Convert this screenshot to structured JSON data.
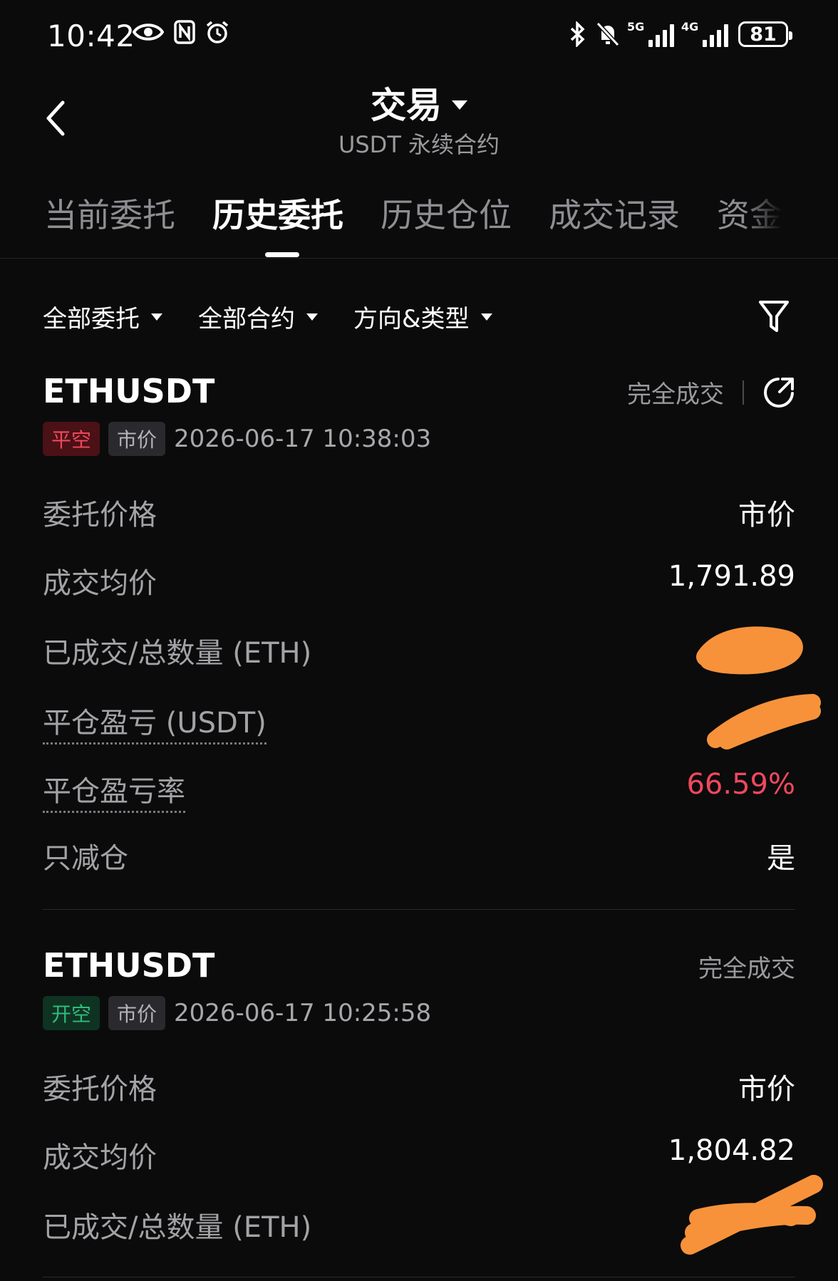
{
  "status_bar": {
    "time": "10:42",
    "icons_left": [
      "eye-icon",
      "nfc-icon",
      "alarm-icon"
    ],
    "icons_right": [
      "bluetooth-icon",
      "mute-icon",
      "signal-5g-icon",
      "signal-4g-icon"
    ],
    "net1": "5G",
    "net2": "4G",
    "battery": "81"
  },
  "header": {
    "title": "交易",
    "subtitle": "USDT 永续合约"
  },
  "tabs": [
    {
      "label": "当前委托",
      "active": false
    },
    {
      "label": "历史委托",
      "active": true
    },
    {
      "label": "历史仓位",
      "active": false
    },
    {
      "label": "成交记录",
      "active": false
    },
    {
      "label": "资金",
      "active": false
    }
  ],
  "filters": [
    {
      "label": "全部委托"
    },
    {
      "label": "全部合约"
    },
    {
      "label": "方向&类型"
    }
  ],
  "orders": [
    {
      "symbol": "ETHUSDT",
      "state": "完全成交",
      "side_tag": "平空",
      "type_tag": "市价",
      "time": "2026-06-17 10:38:03",
      "rows": [
        {
          "label": "委托价格",
          "value": "市价"
        },
        {
          "label": "成交均价",
          "value": "1,791.89"
        },
        {
          "label": "已成交/总数量 (ETH)",
          "value": ""
        },
        {
          "label": "平仓盈亏 (USDT)",
          "value": ""
        },
        {
          "label": "平仓盈亏率",
          "value": "66.59%"
        },
        {
          "label": "只减仓",
          "value": "是"
        }
      ]
    },
    {
      "symbol": "ETHUSDT",
      "state": "完全成交",
      "side_tag": "开空",
      "type_tag": "市价",
      "time": "2026-06-17 10:25:58",
      "rows": [
        {
          "label": "委托价格",
          "value": "市价"
        },
        {
          "label": "成交均价",
          "value": "1,804.82"
        },
        {
          "label": "已成交/总数量 (ETH)",
          "value": ""
        }
      ]
    }
  ],
  "colors": {
    "background": "#0b0b0c",
    "loss_red": "#f0485d",
    "profit_green": "#2ebd7a",
    "redaction": "#f7923a"
  }
}
